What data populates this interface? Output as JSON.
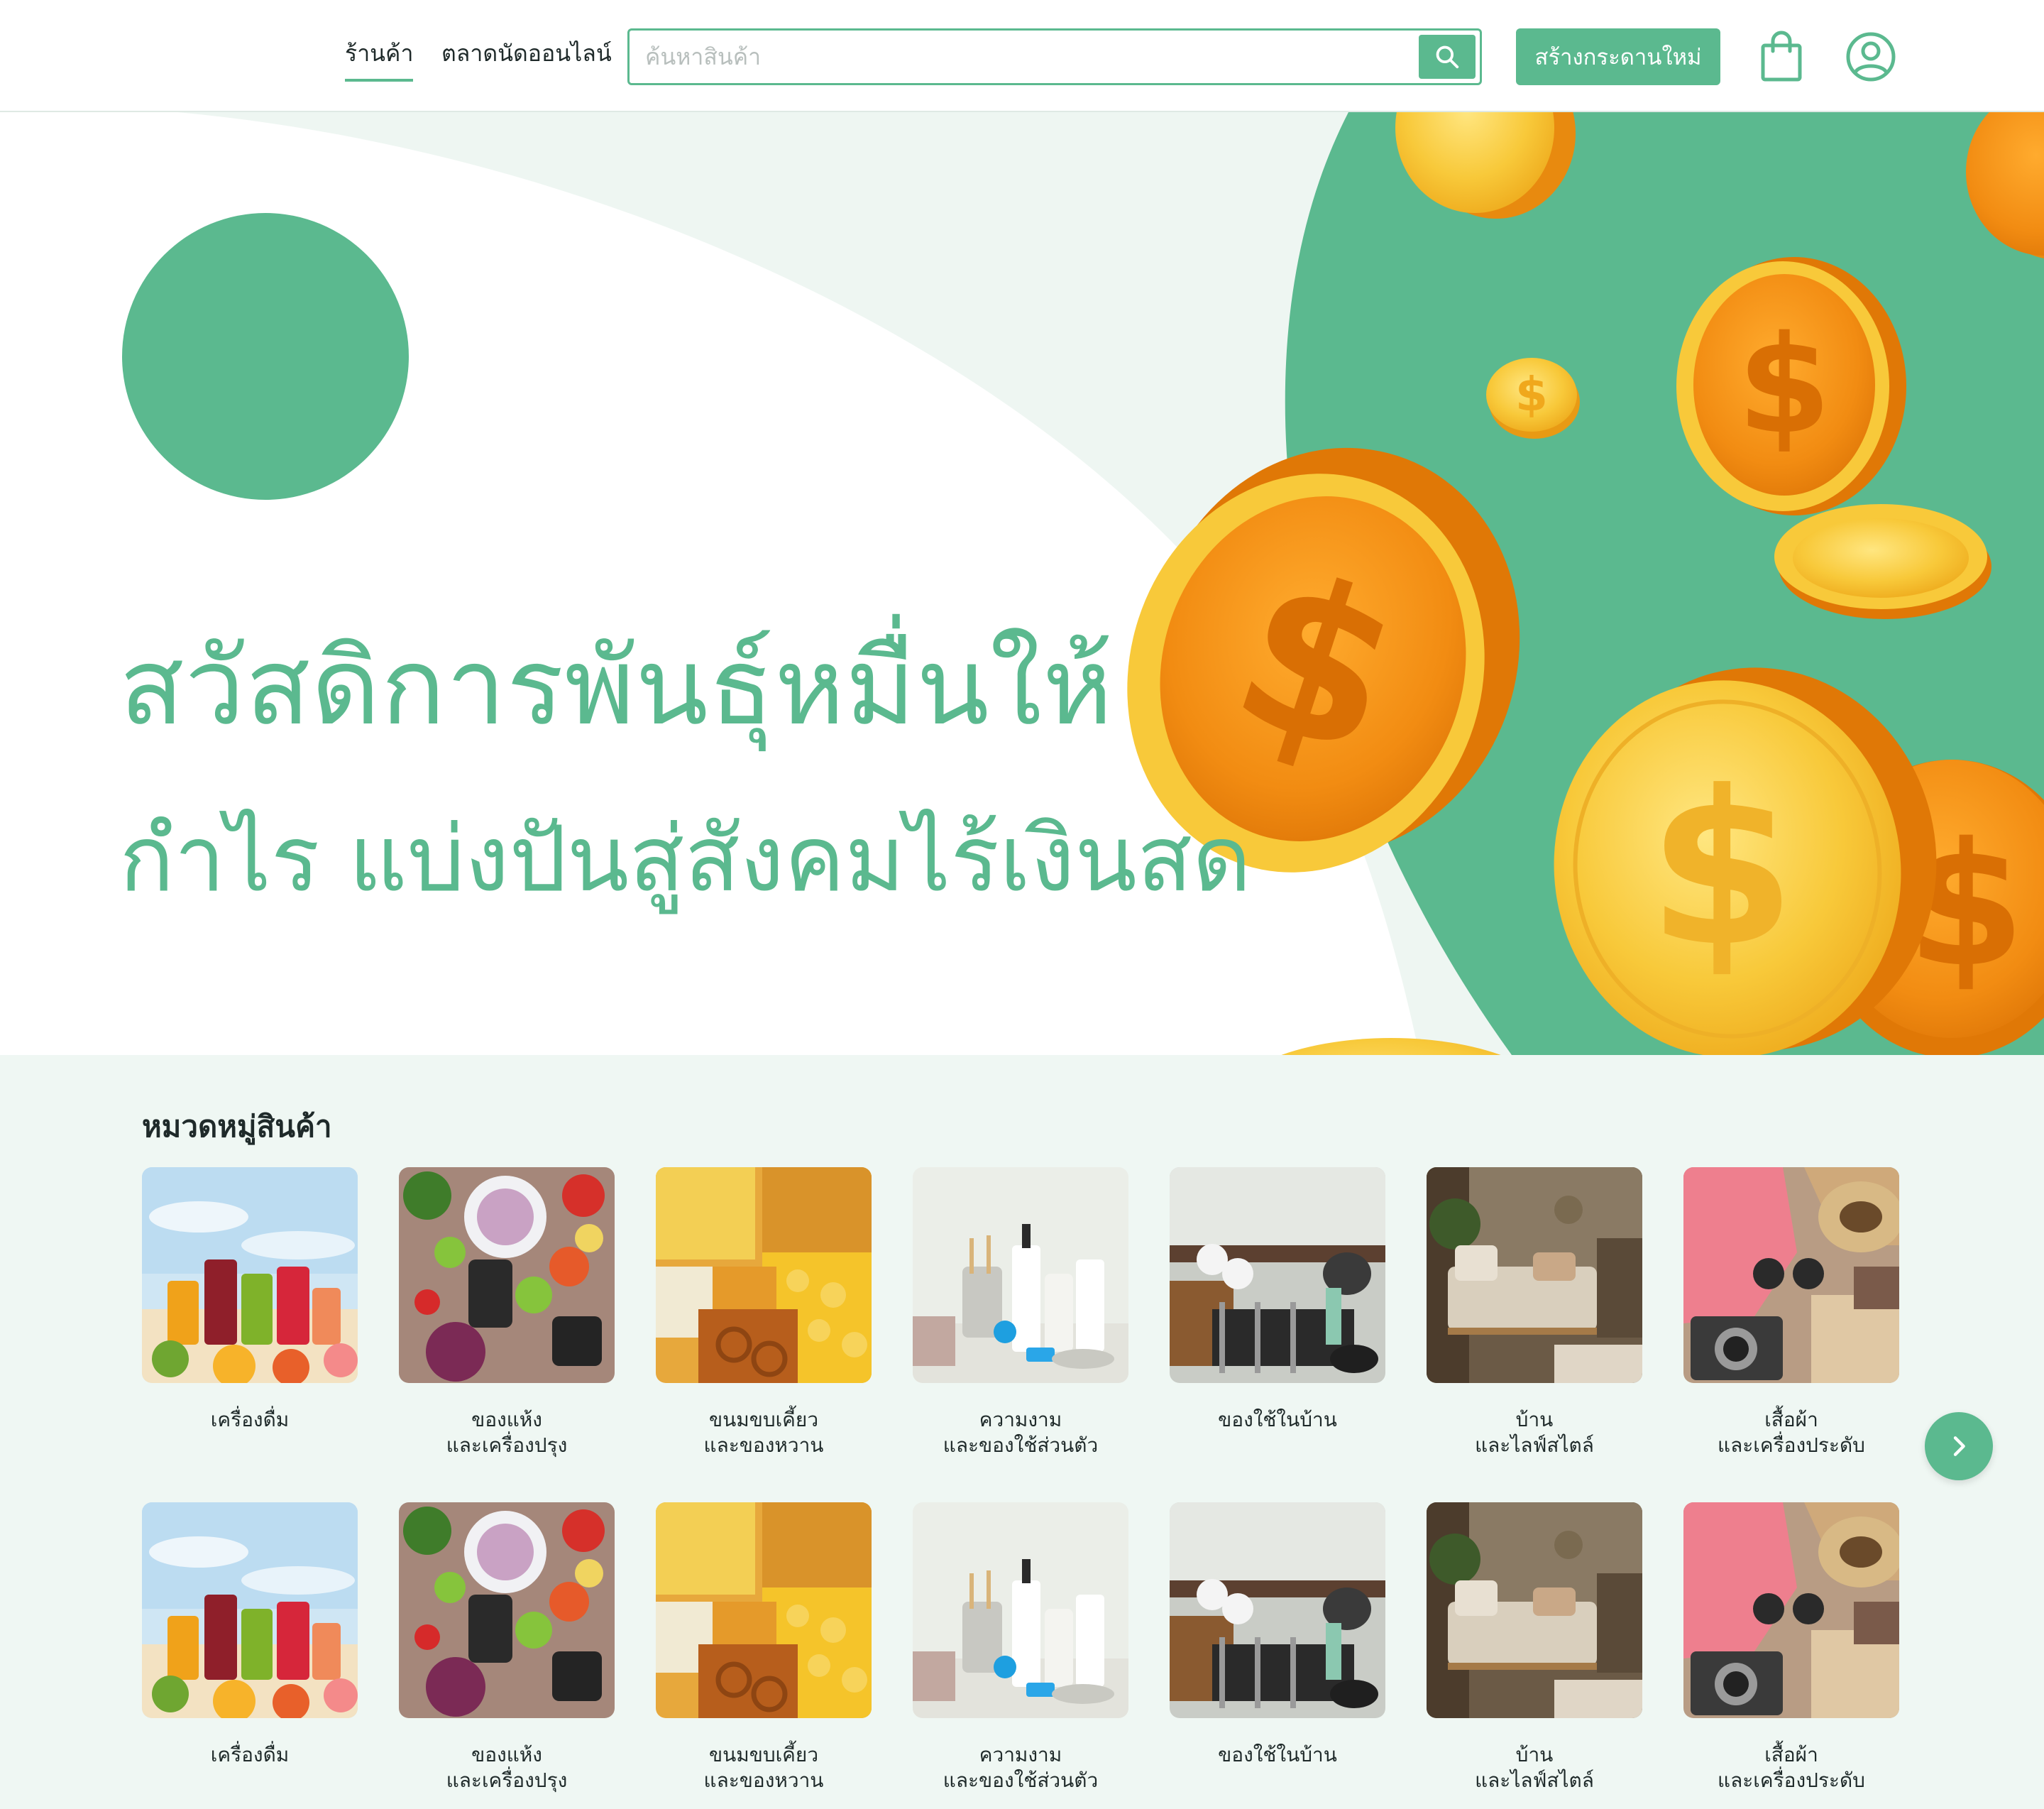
{
  "nav": {
    "links": [
      {
        "label": "ร้านค้า",
        "active": true
      },
      {
        "label": "ตลาดนัดออนไลน์",
        "active": false
      }
    ],
    "search": {
      "placeholder": "ค้นหาสินค้า",
      "value": ""
    },
    "search_icon": "search-icon",
    "create_button": "สร้างกระดานใหม่",
    "cart_icon": "shopping-bag-icon",
    "profile_icon": "user-circle-icon"
  },
  "hero": {
    "line1": "สวัสดิการพันธุ์หมื่นให้",
    "line2": "กำไร แบ่งปันสู่สังคมไร้เงินสด",
    "illustration": "gold-dollar-coins"
  },
  "categories": {
    "title": "หมวดหมู่สินค้า",
    "rows": [
      [
        {
          "line1": "เครื่องดื่ม",
          "line2": "",
          "image": "drinks-photo"
        },
        {
          "line1": "ของแห้ง",
          "line2": "และเครื่องปรุง",
          "image": "dry-food-spices-photo"
        },
        {
          "line1": "ขนมขบเคี้ยว",
          "line2": "และของหวาน",
          "image": "snacks-photo"
        },
        {
          "line1": "ความงาม",
          "line2": "และของใช้ส่วนตัว",
          "image": "beauty-personal-care-photo"
        },
        {
          "line1": "ของใช้ในบ้าน",
          "line2": "",
          "image": "household-items-photo"
        },
        {
          "line1": "บ้าน",
          "line2": "และไลฟ์สไตล์",
          "image": "home-lifestyle-photo"
        },
        {
          "line1": "เสื้อผ้า",
          "line2": "และเครื่องประดับ",
          "image": "clothing-accessories-photo"
        }
      ],
      [
        {
          "line1": "เครื่องดื่ม",
          "line2": "",
          "image": "drinks-photo"
        },
        {
          "line1": "ของแห้ง",
          "line2": "และเครื่องปรุง",
          "image": "dry-food-spices-photo"
        },
        {
          "line1": "ขนมขบเคี้ยว",
          "line2": "และของหวาน",
          "image": "snacks-photo"
        },
        {
          "line1": "ความงาม",
          "line2": "และของใช้ส่วนตัว",
          "image": "beauty-personal-care-photo"
        },
        {
          "line1": "ของใช้ในบ้าน",
          "line2": "",
          "image": "household-items-photo"
        },
        {
          "line1": "บ้าน",
          "line2": "และไลฟ์สไตล์",
          "image": "home-lifestyle-photo"
        },
        {
          "line1": "เสื้อผ้า",
          "line2": "และเครื่องประดับ",
          "image": "clothing-accessories-photo"
        }
      ]
    ],
    "next_icon": "chevron-right-icon"
  },
  "colors": {
    "brand_green": "#5bb98f",
    "section_bg": "#eff7f3",
    "coin_gold": "#f6c431",
    "coin_orange": "#f08a12"
  }
}
